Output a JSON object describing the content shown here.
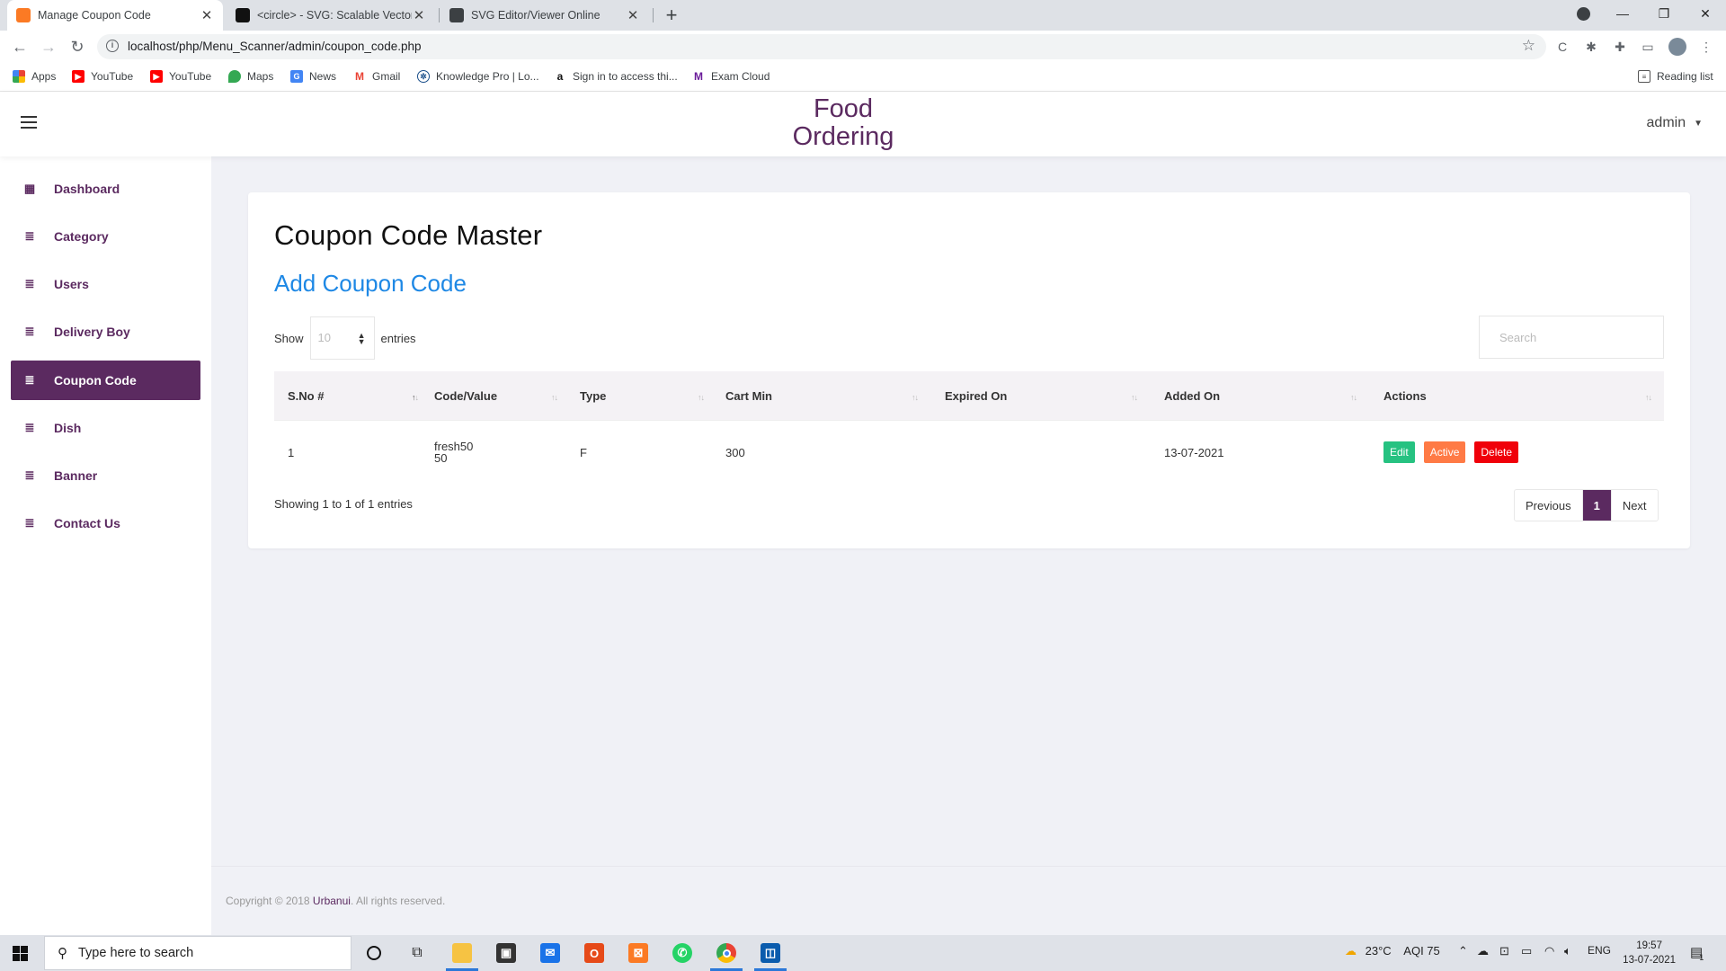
{
  "browser": {
    "tabs": [
      {
        "title": "Manage Coupon Code",
        "active": true
      },
      {
        "title": "<circle> - SVG: Scalable Vector G",
        "active": false
      },
      {
        "title": "SVG Editor/Viewer Online",
        "active": false
      }
    ],
    "url": "localhost/php/Menu_Scanner/admin/coupon_code.php",
    "bookmarks": [
      "Apps",
      "YouTube",
      "YouTube",
      "Maps",
      "News",
      "Gmail",
      "Knowledge Pro | Lo...",
      "Sign in to access thi...",
      "Exam Cloud"
    ],
    "reading_list": "Reading list"
  },
  "header": {
    "brand_line1": "Food",
    "brand_line2": "Ordering",
    "user": "admin"
  },
  "sidebar": {
    "items": [
      {
        "label": "Dashboard",
        "icon": "dashboard-icon",
        "active": false
      },
      {
        "label": "Category",
        "icon": "list-icon",
        "active": false
      },
      {
        "label": "Users",
        "icon": "list-icon",
        "active": false
      },
      {
        "label": "Delivery Boy",
        "icon": "list-icon",
        "active": false
      },
      {
        "label": "Coupon Code",
        "icon": "list-icon",
        "active": true
      },
      {
        "label": "Dish",
        "icon": "list-icon",
        "active": false
      },
      {
        "label": "Banner",
        "icon": "list-icon",
        "active": false
      },
      {
        "label": "Contact Us",
        "icon": "list-icon",
        "active": false
      }
    ]
  },
  "main": {
    "title": "Coupon Code Master",
    "add_link": "Add Coupon Code",
    "show_label": "Show",
    "page_length": "10",
    "entries_label": "entries",
    "search_placeholder": "Search",
    "columns": [
      "S.No #",
      "Code/Value",
      "Type",
      "Cart Min",
      "Expired On",
      "Added On",
      "Actions"
    ],
    "rows": [
      {
        "sno": "1",
        "code": "fresh50",
        "value": "50",
        "type": "F",
        "cart_min": "300",
        "expired_on": "",
        "added_on": "13-07-2021",
        "actions": {
          "edit": "Edit",
          "status": "Active",
          "delete": "Delete"
        }
      }
    ],
    "info": "Showing 1 to 1 of 1 entries",
    "pagination": {
      "previous": "Previous",
      "current": "1",
      "next": "Next"
    }
  },
  "footer": {
    "copyright_prefix": "Copyright © 2018",
    "brand": "Urbanui",
    "copyright_suffix": ". All rights reserved."
  },
  "taskbar": {
    "search_placeholder": "Type here to search",
    "weather": "23°C",
    "aqi": "AQI 75",
    "lang": "ENG",
    "time": "19:57",
    "date": "13-07-2021",
    "notifications": "1"
  },
  "colors": {
    "brand": "#5b2a60",
    "link": "#1e88e5",
    "edit": "#26c281",
    "active": "#ff7a45",
    "delete": "#f0000a"
  }
}
